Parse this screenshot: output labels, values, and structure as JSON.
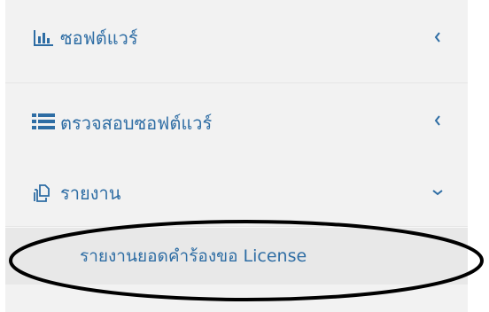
{
  "sidebar": {
    "items": [
      {
        "label": "ซอฟต์แวร์",
        "icon": "bar-chart-icon",
        "chevron": "chevron-left-icon"
      },
      {
        "label": "ตรวจสอบซอฟต์แวร์",
        "icon": "list-icon",
        "chevron": "chevron-left-icon"
      },
      {
        "label": "รายงาน",
        "icon": "copy-icon",
        "chevron": "chevron-down-icon"
      }
    ],
    "submenu": [
      {
        "label": "รายงานยอดคำร้องขอ License"
      }
    ]
  },
  "colors": {
    "link": "#2e6da4",
    "background": "#f2f2f2",
    "submenu_background": "#e8e8e8",
    "annotation": "#000000"
  }
}
